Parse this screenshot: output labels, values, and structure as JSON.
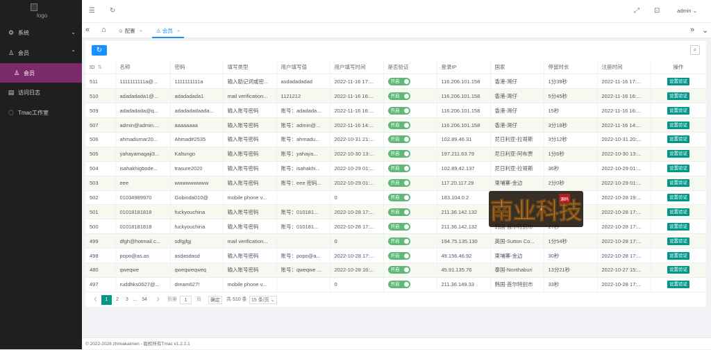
{
  "logo_alt": "logo",
  "sidebar": {
    "items": [
      {
        "icon": "gear-icon",
        "label": "系统"
      },
      {
        "icon": "user-icon",
        "label": "会员"
      },
      {
        "icon": "user-icon",
        "label": "会员"
      },
      {
        "icon": "log-icon",
        "label": "访问日志"
      },
      {
        "icon": "studio-icon",
        "label": "Tmac工作室"
      }
    ]
  },
  "topbar": {
    "user": "admin"
  },
  "tabs": [
    {
      "label": "配置"
    },
    {
      "label": "会员"
    }
  ],
  "table": {
    "headers": [
      "ID",
      "名称",
      "密码",
      "填写类型",
      "用户填写值",
      "用户填写时间",
      "是否验证",
      "登录IP",
      "国家",
      "停留时长",
      "注册时间",
      "操作"
    ],
    "toggle_label": "开启",
    "action_label": "设置验证",
    "rows": [
      [
        "511",
        "1111111111a@...",
        "1111111111a",
        "输入助记词或密...",
        "asdadadadad",
        "2022-11-16 17:...",
        "116.206.101.158",
        "香港-灣仔",
        "1分39秒",
        "2022-11-16 17:..."
      ],
      [
        "510",
        "adadadada1@...",
        "adadadada1",
        "mail verification...",
        "1121212",
        "2022-11-16 16:...",
        "116.206.101.158",
        "香港-灣仔",
        "5分45秒",
        "2022-11-16 16:..."
      ],
      [
        "509",
        "adadadada@q...",
        "adadadadaada...",
        "输入账号密码",
        "账号：adadada...",
        "2022-11-16 16:...",
        "116.206.101.158",
        "香港-灣仔",
        "15秒",
        "2022-11-16 16:..."
      ],
      [
        "507",
        "admin@admin....",
        "aaaaaaaa",
        "输入账号密码",
        "账号：admin@...",
        "2022-11-16 14:...",
        "116.206.101.158",
        "香港-灣仔",
        "3分18秒",
        "2022-11-16 14:..."
      ],
      [
        "506",
        "ahmadumar20...",
        "Ahmad#2535",
        "输入账号密码",
        "账号：ahmadu...",
        "2022-10-31 21:...",
        "102.89.46.31",
        "尼日利亚-拉哥斯",
        "3分12秒",
        "2022-10-31 20:..."
      ],
      [
        "505",
        "yahayamagaji3...",
        "Kaltungo",
        "输入账号密码",
        "账号：yahaya...",
        "2022-10-30 13:...",
        "197.211.63.79",
        "尼日利亚-阿布贾",
        "1分6秒",
        "2022-10-30 13:..."
      ],
      [
        "504",
        "isahakhigbode...",
        "trasure2020",
        "输入账号密码",
        "账号：isahakhi...",
        "2022-10-29 01:...",
        "102.89.42.137",
        "尼日利亚-拉哥斯",
        "36秒",
        "2022-10-29 01:..."
      ],
      [
        "503",
        "eee",
        "wwwwwwwww",
        "输入账号密码",
        "账号：eee 密码...",
        "2022-10-29 01:...",
        "117.20.117.29",
        "柬埔寨-金边",
        "2分0秒",
        "2022-10-29 01:..."
      ],
      [
        "502",
        "01034989970",
        "Gobinda010@",
        "mobile phone v...",
        "",
        "0",
        "183.104.0.2",
        "",
        "",
        "2022-10-28 19:..."
      ],
      [
        "501",
        "01018181818",
        "fuckyouchina",
        "输入账号密码",
        "账号：010181...",
        "2022-10-28 17:...",
        "211.36.142.132",
        "",
        "",
        "2022-10-28 17:..."
      ],
      [
        "500",
        "01018181818",
        "fuckyouchina",
        "输入账号密码",
        "账号：010181...",
        "2022-10-28 17:...",
        "211.36.142.132",
        "韩国-首尔特别市",
        "27秒",
        "2022-10-28 17:..."
      ],
      [
        "499",
        "dfgh@hotmail.c...",
        "sdfgjfgj",
        "mail verification...",
        "",
        "0",
        "194.75.135.130",
        "英国-Sutton Co...",
        "1分54秒",
        "2022-10-28 17:..."
      ],
      [
        "498",
        "popo@as.as",
        "asdasdasd",
        "输入账号密码",
        "账号：popo@a...",
        "2022-10-28 17:...",
        "49.156.46.92",
        "柬埔寨-金边",
        "30秒",
        "2022-10-28 17:..."
      ],
      [
        "480",
        "qweqwe",
        "qweqweqweq",
        "输入账号密码",
        "账号：qweqwe ...",
        "2022-10-28 16:...",
        "45.91.135.76",
        "泰国-Nonthaburi",
        "13分21秒",
        "2022-10-27 15:..."
      ],
      [
        "497",
        "ruddhks0627@...",
        "dream627!",
        "mobile phone v...",
        "",
        "0",
        "211.36.149.33",
        "韩国-首尔特别市",
        "33秒",
        "2022-10-28 17:..."
      ]
    ]
  },
  "pager": {
    "prev": "〈",
    "pages": [
      "1",
      "2",
      "3",
      "…",
      "34"
    ],
    "next": "〉",
    "goto_label": "到第",
    "page_value": "1",
    "page_unit": "页",
    "confirm": "确定",
    "total": "共 510 条",
    "size": "15 条/页"
  },
  "footer": "© 2022-2028 zhimakaimen - 版权所有Tmac v1.2.2.1",
  "watermark": {
    "text": "南业科技",
    "seal": "源码"
  }
}
